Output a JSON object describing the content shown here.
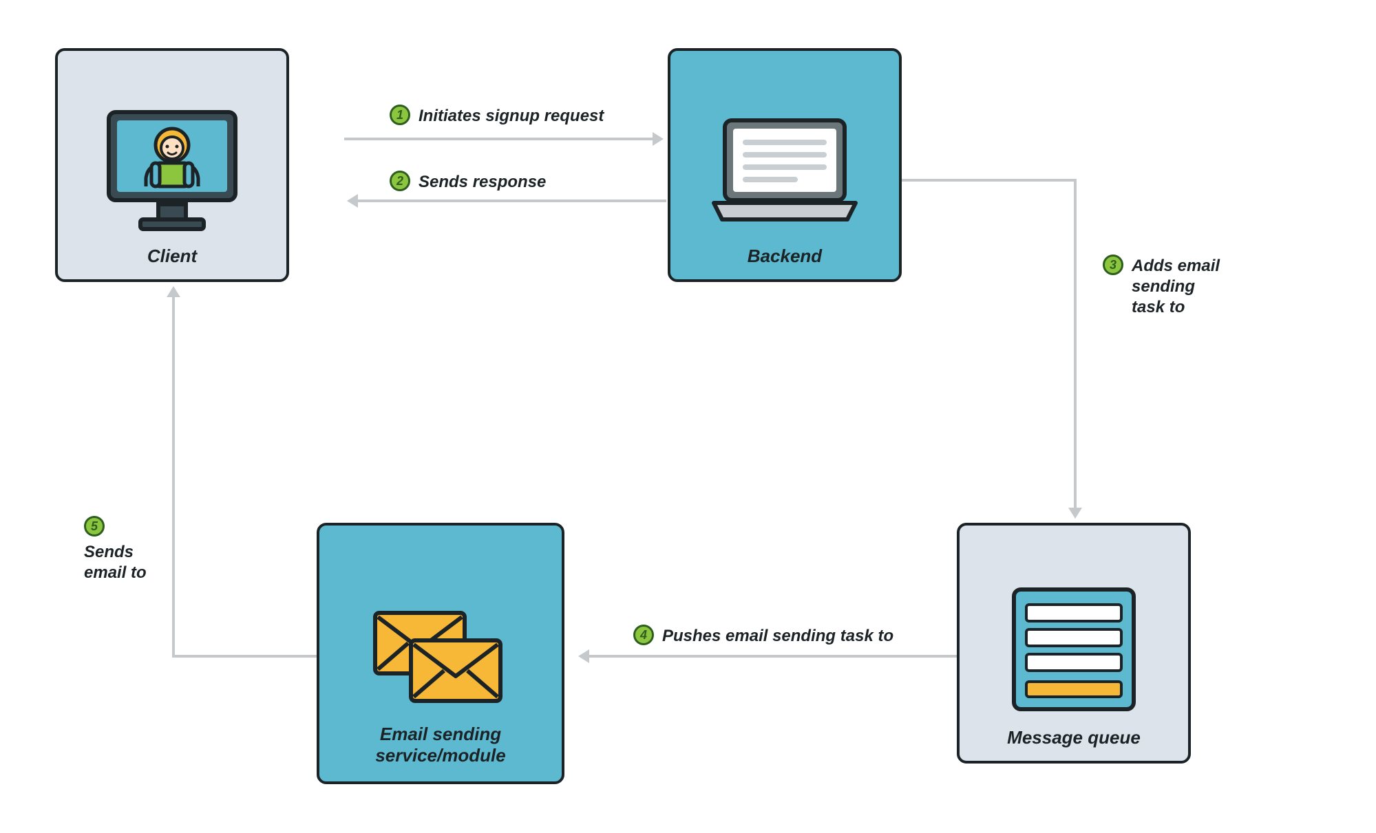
{
  "colors": {
    "node_pale": "#dde3ea",
    "node_teal": "#5cb9cf",
    "stroke": "#1c2326",
    "accent_yellow": "#f7b737",
    "accent_green_fill": "#8cc63f",
    "accent_green_stroke": "#2e5e1f",
    "arrow": "#c5c9cc"
  },
  "nodes": {
    "client": {
      "label": "Client",
      "icon": "client-monitor-icon"
    },
    "backend": {
      "label": "Backend",
      "icon": "laptop-icon"
    },
    "message_queue": {
      "label": "Message queue",
      "icon": "queue-form-icon"
    },
    "email_service": {
      "label": "Email sending\nservice/module",
      "icon": "envelopes-icon"
    }
  },
  "steps": {
    "s1": {
      "num": "1",
      "text": "Initiates signup request"
    },
    "s2": {
      "num": "2",
      "text": "Sends response"
    },
    "s3": {
      "num": "3",
      "text": "Adds email\nsending\ntask to"
    },
    "s4": {
      "num": "4",
      "text": "Pushes email sending task to"
    },
    "s5": {
      "num": "5",
      "text": "Sends\nemail to"
    }
  }
}
